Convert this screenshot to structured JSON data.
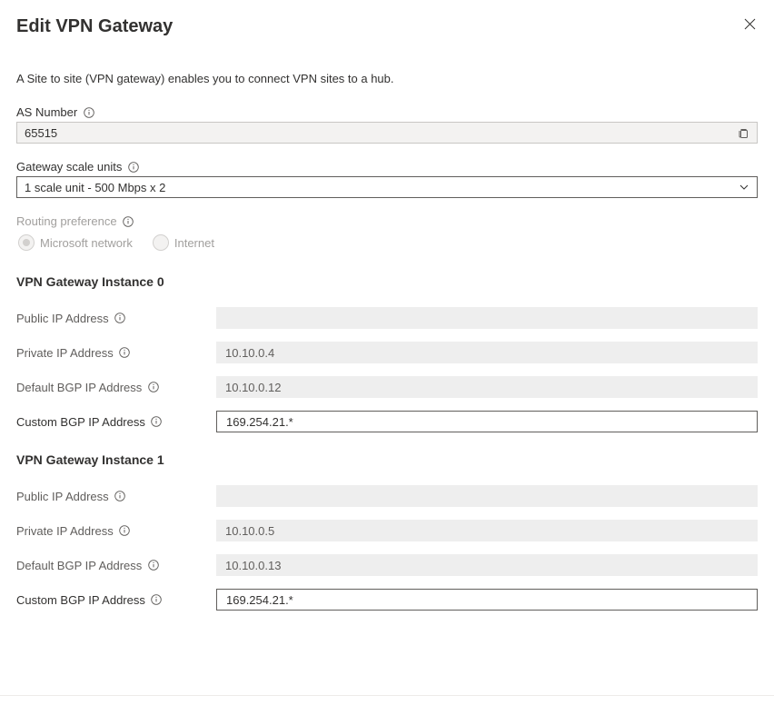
{
  "header": {
    "title": "Edit VPN Gateway"
  },
  "description": "A Site to site (VPN gateway) enables you to connect VPN sites to a hub.",
  "as_number": {
    "label": "AS Number",
    "value": "65515"
  },
  "gateway_scale": {
    "label": "Gateway scale units",
    "value": "1 scale unit - 500 Mbps x 2"
  },
  "routing_preference": {
    "label": "Routing preference",
    "options": {
      "microsoft": "Microsoft network",
      "internet": "Internet"
    }
  },
  "instance0": {
    "heading": "VPN Gateway Instance 0",
    "public_ip": {
      "label": "Public IP Address",
      "value": ""
    },
    "private_ip": {
      "label": "Private IP Address",
      "value": "10.10.0.4"
    },
    "default_bgp": {
      "label": "Default BGP IP Address",
      "value": "10.10.0.12"
    },
    "custom_bgp": {
      "label": "Custom BGP IP Address",
      "value": "169.254.21.*"
    }
  },
  "instance1": {
    "heading": "VPN Gateway Instance 1",
    "public_ip": {
      "label": "Public IP Address",
      "value": ""
    },
    "private_ip": {
      "label": "Private IP Address",
      "value": "10.10.0.5"
    },
    "default_bgp": {
      "label": "Default BGP IP Address",
      "value": "10.10.0.13"
    },
    "custom_bgp": {
      "label": "Custom BGP IP Address",
      "value": "169.254.21.*"
    }
  }
}
